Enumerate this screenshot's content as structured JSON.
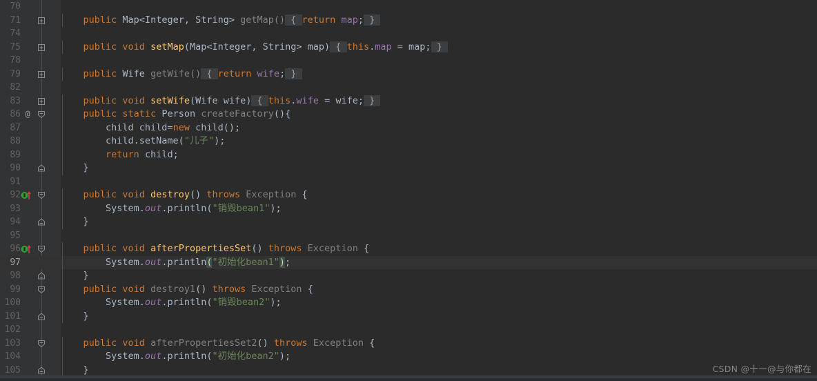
{
  "editor": {
    "theme": "darcula",
    "background": "#2b2b2b",
    "gutter_background": "#313335",
    "current_line_background": "#323232",
    "current_line": 97,
    "first_visible_line": 70,
    "last_visible_line": 105,
    "colors": {
      "keyword": "#cc7832",
      "method_declaration": "#ffc66d",
      "field": "#9876aa",
      "string": "#6a8759",
      "grayed": "#808080",
      "default_text": "#a9b7c6",
      "line_number": "#606366",
      "folded_region_background": "#3c3f41",
      "matched_paren_background": "#3b514d"
    }
  },
  "watermark": {
    "text": "CSDN @十一@与你都在"
  },
  "lines": [
    {
      "num": "70",
      "fold": "none",
      "marker": "none",
      "tokens": []
    },
    {
      "num": "71",
      "fold": "collapsed",
      "marker": "none",
      "tokens": [
        {
          "t": "    ",
          "c": "plain"
        },
        {
          "t": "public",
          "c": "kw"
        },
        {
          "t": " Map<Integer, String> ",
          "c": "type"
        },
        {
          "t": "getMap()",
          "c": "gray"
        },
        {
          "t": " { ",
          "c": "foldbg"
        },
        {
          "t": "return",
          "c": "kw"
        },
        {
          "t": " ",
          "c": "plain"
        },
        {
          "t": "map",
          "c": "fld"
        },
        {
          "t": ";",
          "c": "plain"
        },
        {
          "t": " } ",
          "c": "foldbg"
        }
      ]
    },
    {
      "num": "74",
      "fold": "none",
      "marker": "none",
      "tokens": []
    },
    {
      "num": "75",
      "fold": "collapsed",
      "marker": "none",
      "tokens": [
        {
          "t": "    ",
          "c": "plain"
        },
        {
          "t": "public void",
          "c": "kw"
        },
        {
          "t": " ",
          "c": "plain"
        },
        {
          "t": "setMap",
          "c": "meth"
        },
        {
          "t": "(Map<Integer, String> map)",
          "c": "type"
        },
        {
          "t": " { ",
          "c": "foldbg"
        },
        {
          "t": "this",
          "c": "kw"
        },
        {
          "t": ".",
          "c": "plain"
        },
        {
          "t": "map",
          "c": "fld"
        },
        {
          "t": " = map;",
          "c": "plain"
        },
        {
          "t": " } ",
          "c": "foldbg"
        }
      ]
    },
    {
      "num": "78",
      "fold": "none",
      "marker": "none",
      "tokens": []
    },
    {
      "num": "79",
      "fold": "collapsed",
      "marker": "none",
      "tokens": [
        {
          "t": "    ",
          "c": "plain"
        },
        {
          "t": "public",
          "c": "kw"
        },
        {
          "t": " Wife ",
          "c": "type"
        },
        {
          "t": "getWife()",
          "c": "gray"
        },
        {
          "t": " { ",
          "c": "foldbg"
        },
        {
          "t": "return",
          "c": "kw"
        },
        {
          "t": " ",
          "c": "plain"
        },
        {
          "t": "wife",
          "c": "fld"
        },
        {
          "t": ";",
          "c": "plain"
        },
        {
          "t": " } ",
          "c": "foldbg"
        }
      ]
    },
    {
      "num": "82",
      "fold": "none",
      "marker": "none",
      "tokens": []
    },
    {
      "num": "83",
      "fold": "collapsed",
      "marker": "none",
      "tokens": [
        {
          "t": "    ",
          "c": "plain"
        },
        {
          "t": "public void",
          "c": "kw"
        },
        {
          "t": " ",
          "c": "plain"
        },
        {
          "t": "setWife",
          "c": "meth"
        },
        {
          "t": "(Wife wife)",
          "c": "type"
        },
        {
          "t": " { ",
          "c": "foldbg"
        },
        {
          "t": "this",
          "c": "kw"
        },
        {
          "t": ".",
          "c": "plain"
        },
        {
          "t": "wife",
          "c": "fld"
        },
        {
          "t": " = wife;",
          "c": "plain"
        },
        {
          "t": " } ",
          "c": "foldbg"
        }
      ]
    },
    {
      "num": "86",
      "fold": "expanded",
      "marker": "annotation",
      "tokens": [
        {
          "t": "    ",
          "c": "plain"
        },
        {
          "t": "public static",
          "c": "kw"
        },
        {
          "t": " Person ",
          "c": "type"
        },
        {
          "t": "createFactory",
          "c": "gray"
        },
        {
          "t": "(){",
          "c": "plain"
        }
      ]
    },
    {
      "num": "87",
      "fold": "none",
      "marker": "none",
      "tokens": [
        {
          "t": "        child child=",
          "c": "plain"
        },
        {
          "t": "new",
          "c": "kw"
        },
        {
          "t": " child();",
          "c": "plain"
        }
      ]
    },
    {
      "num": "88",
      "fold": "none",
      "marker": "none",
      "tokens": [
        {
          "t": "        child.setName(",
          "c": "plain"
        },
        {
          "t": "\"儿子\"",
          "c": "str"
        },
        {
          "t": ");",
          "c": "plain"
        }
      ]
    },
    {
      "num": "89",
      "fold": "none",
      "marker": "none",
      "tokens": [
        {
          "t": "        ",
          "c": "plain"
        },
        {
          "t": "return",
          "c": "kw"
        },
        {
          "t": " child;",
          "c": "plain"
        }
      ]
    },
    {
      "num": "90",
      "fold": "end",
      "marker": "none",
      "tokens": [
        {
          "t": "    }",
          "c": "plain"
        }
      ]
    },
    {
      "num": "91",
      "fold": "none",
      "marker": "none",
      "tokens": []
    },
    {
      "num": "92",
      "fold": "expanded",
      "marker": "implements",
      "tokens": [
        {
          "t": "    ",
          "c": "plain"
        },
        {
          "t": "public void",
          "c": "kw"
        },
        {
          "t": " ",
          "c": "plain"
        },
        {
          "t": "destroy",
          "c": "meth"
        },
        {
          "t": "() ",
          "c": "plain"
        },
        {
          "t": "throws",
          "c": "kw"
        },
        {
          "t": " Exception ",
          "c": "gray"
        },
        {
          "t": "{",
          "c": "plain"
        }
      ]
    },
    {
      "num": "93",
      "fold": "none",
      "marker": "none",
      "tokens": [
        {
          "t": "        System.",
          "c": "plain"
        },
        {
          "t": "out",
          "c": "fld ital"
        },
        {
          "t": ".println(",
          "c": "plain"
        },
        {
          "t": "\"销毁bean1\"",
          "c": "str"
        },
        {
          "t": ");",
          "c": "plain"
        }
      ]
    },
    {
      "num": "94",
      "fold": "end",
      "marker": "none",
      "tokens": [
        {
          "t": "    }",
          "c": "plain"
        }
      ]
    },
    {
      "num": "95",
      "fold": "none",
      "marker": "none",
      "tokens": []
    },
    {
      "num": "96",
      "fold": "expanded",
      "marker": "implements",
      "tokens": [
        {
          "t": "    ",
          "c": "plain"
        },
        {
          "t": "public void",
          "c": "kw"
        },
        {
          "t": " ",
          "c": "plain"
        },
        {
          "t": "afterPropertiesSet",
          "c": "meth"
        },
        {
          "t": "() ",
          "c": "plain"
        },
        {
          "t": "throws",
          "c": "kw"
        },
        {
          "t": " Exception ",
          "c": "gray"
        },
        {
          "t": "{",
          "c": "plain"
        }
      ]
    },
    {
      "num": "97",
      "fold": "none",
      "marker": "none",
      "current": true,
      "tokens": [
        {
          "t": "        System.",
          "c": "plain"
        },
        {
          "t": "out",
          "c": "fld ital"
        },
        {
          "t": ".println",
          "c": "plain"
        },
        {
          "t": "(",
          "c": "paren-hl"
        },
        {
          "t": "\"初始化bean1\"",
          "c": "str"
        },
        {
          "t": ")",
          "c": "paren-hl"
        },
        {
          "t": ";",
          "c": "plain"
        }
      ]
    },
    {
      "num": "98",
      "fold": "end",
      "marker": "none",
      "tokens": [
        {
          "t": "    }",
          "c": "plain"
        }
      ]
    },
    {
      "num": "99",
      "fold": "expanded",
      "marker": "none",
      "tokens": [
        {
          "t": "    ",
          "c": "plain"
        },
        {
          "t": "public void",
          "c": "kw"
        },
        {
          "t": " ",
          "c": "plain"
        },
        {
          "t": "destroy1",
          "c": "gray"
        },
        {
          "t": "() ",
          "c": "plain"
        },
        {
          "t": "throws",
          "c": "kw"
        },
        {
          "t": " Exception ",
          "c": "gray"
        },
        {
          "t": "{",
          "c": "plain"
        }
      ]
    },
    {
      "num": "100",
      "fold": "none",
      "marker": "none",
      "tokens": [
        {
          "t": "        System.",
          "c": "plain"
        },
        {
          "t": "out",
          "c": "fld ital"
        },
        {
          "t": ".println(",
          "c": "plain"
        },
        {
          "t": "\"销毁bean2\"",
          "c": "str"
        },
        {
          "t": ");",
          "c": "plain"
        }
      ]
    },
    {
      "num": "101",
      "fold": "end",
      "marker": "none",
      "tokens": [
        {
          "t": "    }",
          "c": "plain"
        }
      ]
    },
    {
      "num": "102",
      "fold": "none",
      "marker": "none",
      "tokens": []
    },
    {
      "num": "103",
      "fold": "expanded",
      "marker": "none",
      "tokens": [
        {
          "t": "    ",
          "c": "plain"
        },
        {
          "t": "public void",
          "c": "kw"
        },
        {
          "t": " ",
          "c": "plain"
        },
        {
          "t": "afterPropertiesSet2",
          "c": "gray"
        },
        {
          "t": "() ",
          "c": "plain"
        },
        {
          "t": "throws",
          "c": "kw"
        },
        {
          "t": " Exception ",
          "c": "gray"
        },
        {
          "t": "{",
          "c": "plain"
        }
      ]
    },
    {
      "num": "104",
      "fold": "none",
      "marker": "none",
      "tokens": [
        {
          "t": "        System.",
          "c": "plain"
        },
        {
          "t": "out",
          "c": "fld ital"
        },
        {
          "t": ".println(",
          "c": "plain"
        },
        {
          "t": "\"初始化bean2\"",
          "c": "str"
        },
        {
          "t": ");",
          "c": "plain"
        }
      ]
    },
    {
      "num": "105",
      "fold": "end",
      "marker": "none",
      "tokens": [
        {
          "t": "    }",
          "c": "plain"
        }
      ]
    }
  ]
}
